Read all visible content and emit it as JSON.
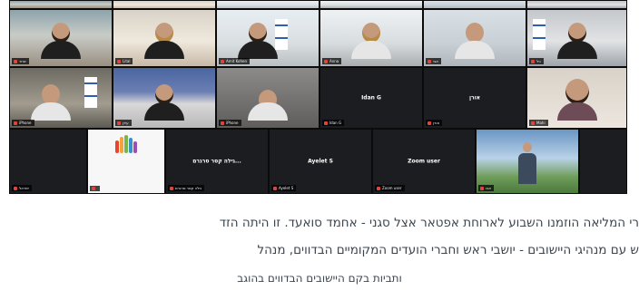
{
  "meeting": {
    "participants": [
      {
        "id": "p1",
        "display_name": "",
        "label": "שחר",
        "kind": "photo"
      },
      {
        "id": "p2",
        "display_name": "",
        "label": "Lital",
        "kind": "photo"
      },
      {
        "id": "p3",
        "display_name": "",
        "label": "Amit Kohen",
        "kind": "photo"
      },
      {
        "id": "p4",
        "display_name": "",
        "label": "Anna",
        "kind": "photo"
      },
      {
        "id": "p5",
        "display_name": "",
        "label": "אבי",
        "kind": "photo"
      },
      {
        "id": "p6",
        "display_name": "",
        "label": "גיל",
        "kind": "photo"
      },
      {
        "id": "p7",
        "display_name": "",
        "label": "iPhone",
        "kind": "photo"
      },
      {
        "id": "p8",
        "display_name": "",
        "label": "עידן",
        "kind": "photo"
      },
      {
        "id": "p9",
        "display_name": "",
        "label": "iPhone",
        "kind": "photo"
      },
      {
        "id": "p10",
        "display_name": "Idan G",
        "label": "Idan G",
        "kind": "name"
      },
      {
        "id": "p11",
        "display_name": "אורן",
        "label": "אורן",
        "kind": "name"
      },
      {
        "id": "p12",
        "display_name": "",
        "label": "Mahi",
        "kind": "photo"
      },
      {
        "id": "p13",
        "display_name": "",
        "label": "ישראל",
        "kind": "photo"
      },
      {
        "id": "p14",
        "display_name": "",
        "label": "",
        "kind": "logo"
      },
      {
        "id": "p15",
        "display_name": "גילה קסר סרגרם...",
        "label": "גילה קסר סרגרם",
        "kind": "name"
      },
      {
        "id": "p16",
        "display_name": "Ayelet S",
        "label": "Ayelet S",
        "kind": "name"
      },
      {
        "id": "p17",
        "display_name": "Zoom user",
        "label": "Zoom user",
        "kind": "name"
      },
      {
        "id": "p18",
        "display_name": "",
        "label": "אבו",
        "kind": "photo"
      }
    ]
  },
  "article": {
    "line1": "רי המליאה הוזמנו השבוע לארוחת אפטאר אצל סגני - אחמד סואעד. זו היתה הזד",
    "line2": "ש עם מנהיגי היישובים - יושבי ראש וחברי הועדים המקומיים הבדווים, מנהל",
    "line3": "ותביות בקם היישובים הבדווים בהוגב"
  },
  "colors": {
    "grid_background": "#0b0b0b",
    "tile_dark": "#1b1d21",
    "mic_muted": "#e0443a",
    "article_text": "#3c4650"
  }
}
